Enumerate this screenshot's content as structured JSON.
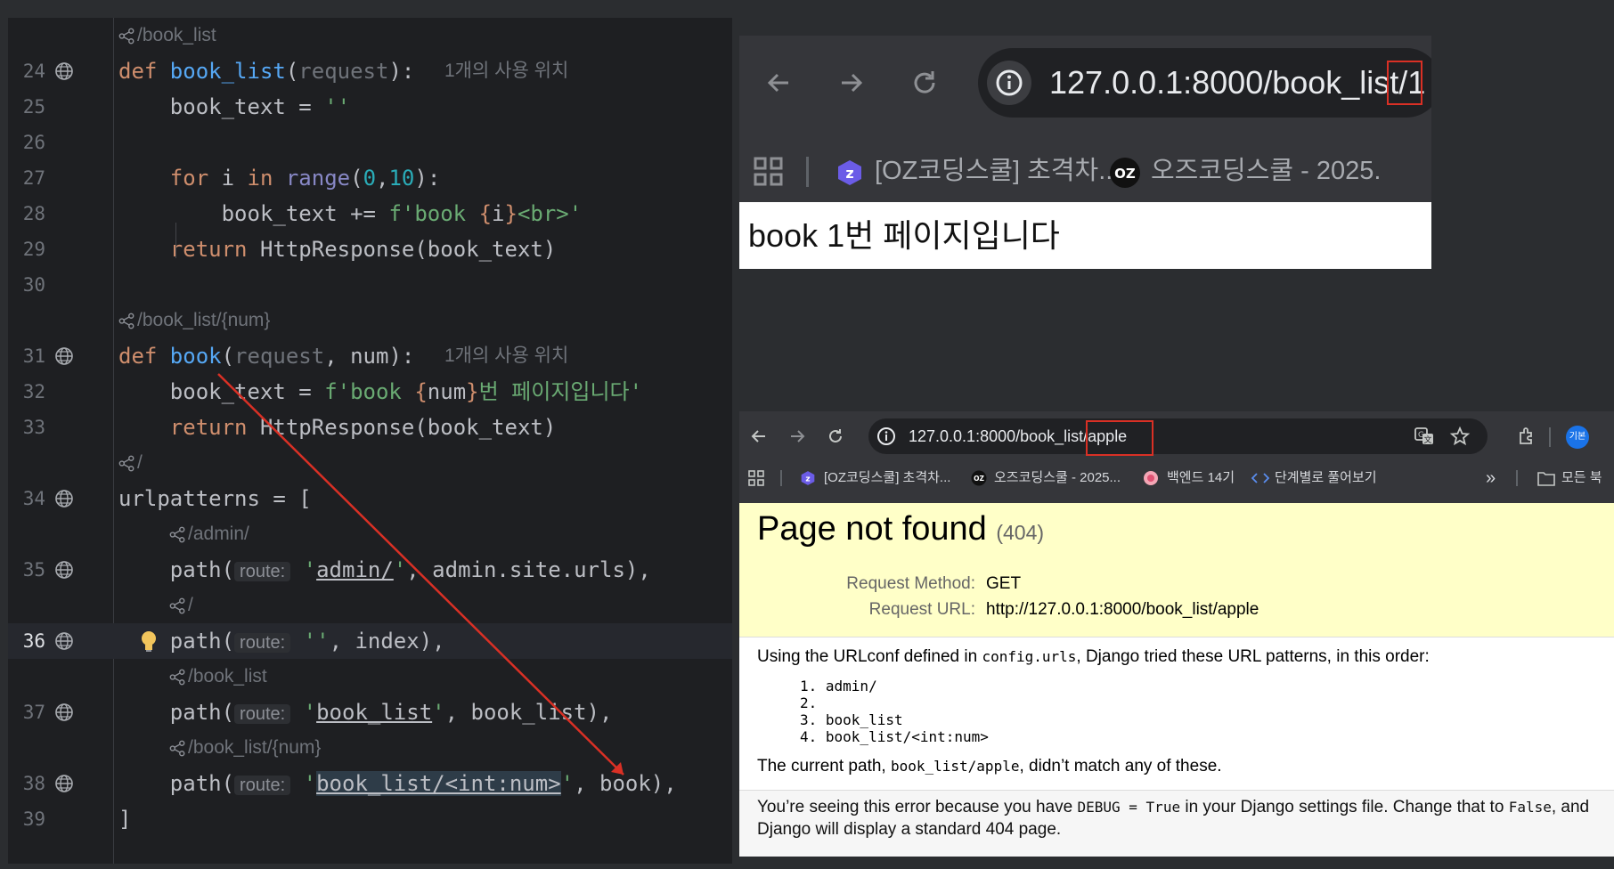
{
  "editor": {
    "lines": [
      {
        "type": "hint",
        "text": "/book_list",
        "indent": 0
      },
      {
        "type": "code",
        "num": "24",
        "globe": true,
        "usage": "1개의 사용 위치",
        "tokens": [
          [
            "kw",
            "def "
          ],
          [
            "fn",
            "book_list"
          ],
          [
            "",
            "("
          ],
          [
            "pa",
            "request"
          ],
          [
            "",
            "):"
          ]
        ]
      },
      {
        "type": "code",
        "num": "25",
        "tokens": [
          [
            "",
            "    book_text = "
          ],
          [
            "str",
            "''"
          ]
        ]
      },
      {
        "type": "code",
        "num": "26",
        "tokens": []
      },
      {
        "type": "code",
        "num": "27",
        "tokens": [
          [
            "kw",
            "    for "
          ],
          [
            "",
            "i "
          ],
          [
            "kw",
            "in "
          ],
          [
            "bi",
            "range"
          ],
          [
            "",
            "("
          ],
          [
            "num",
            "0"
          ],
          [
            "",
            ","
          ],
          [
            "num",
            "10"
          ],
          [
            "",
            "):"
          ]
        ]
      },
      {
        "type": "code",
        "num": "28",
        "tokens": [
          [
            "",
            "        book_text += "
          ],
          [
            "str",
            "f'book "
          ],
          [
            "br",
            "{"
          ],
          [
            "",
            "i"
          ],
          [
            "br",
            "}"
          ],
          [
            "str",
            "<br>'"
          ]
        ]
      },
      {
        "type": "code",
        "num": "29",
        "tokens": [
          [
            "kw",
            "    return "
          ],
          [
            "",
            "HttpResponse(book_text)"
          ]
        ]
      },
      {
        "type": "code",
        "num": "30",
        "tokens": []
      },
      {
        "type": "hint",
        "text": "/book_list/{num}",
        "indent": 0
      },
      {
        "type": "code",
        "num": "31",
        "globe": true,
        "usage": "1개의 사용 위치",
        "tokens": [
          [
            "kw",
            "def "
          ],
          [
            "fn",
            "book"
          ],
          [
            "",
            "("
          ],
          [
            "pa",
            "request"
          ],
          [
            "",
            ", num):"
          ]
        ]
      },
      {
        "type": "code",
        "num": "32",
        "tokens": [
          [
            "",
            "    book_text = "
          ],
          [
            "str",
            "f'book "
          ],
          [
            "br",
            "{"
          ],
          [
            "",
            "num"
          ],
          [
            "br",
            "}"
          ],
          [
            "str",
            "번 페이지입니다'"
          ]
        ]
      },
      {
        "type": "code",
        "num": "33",
        "tokens": [
          [
            "kw",
            "    return "
          ],
          [
            "",
            "HttpResponse(book_text)"
          ]
        ]
      },
      {
        "type": "hint",
        "text": "/",
        "indent": 0
      },
      {
        "type": "code",
        "num": "34",
        "globe": true,
        "tokens": [
          [
            "",
            "urlpatterns = ["
          ]
        ]
      },
      {
        "type": "hint",
        "text": "/admin/",
        "indent": 1
      },
      {
        "type": "code",
        "num": "35",
        "globe": true,
        "tokens": [
          [
            "",
            "    path("
          ],
          [
            "inlay",
            "route:"
          ],
          [
            "",
            " "
          ],
          [
            "str",
            "'"
          ],
          [
            "uhl",
            "admin/"
          ],
          [
            "str",
            "'"
          ],
          [
            "",
            ", admin.site.urls),"
          ]
        ]
      },
      {
        "type": "hint",
        "text": "/",
        "indent": 1
      },
      {
        "type": "code",
        "num": "36",
        "globe": true,
        "current": true,
        "bulb": true,
        "tokens": [
          [
            "",
            "    path("
          ],
          [
            "inlay",
            "route:"
          ],
          [
            "",
            " "
          ],
          [
            "str",
            "''"
          ],
          [
            "",
            ", index),"
          ]
        ]
      },
      {
        "type": "hint",
        "text": "/book_list",
        "indent": 1
      },
      {
        "type": "code",
        "num": "37",
        "globe": true,
        "tokens": [
          [
            "",
            "    path("
          ],
          [
            "inlay",
            "route:"
          ],
          [
            "",
            " "
          ],
          [
            "str",
            "'"
          ],
          [
            "uhl",
            "book_list"
          ],
          [
            "str",
            "'"
          ],
          [
            "",
            ", book_list),"
          ]
        ]
      },
      {
        "type": "hint",
        "text": "/book_list/{num}",
        "indent": 1
      },
      {
        "type": "code",
        "num": "38",
        "globe": true,
        "tokens": [
          [
            "",
            "    path("
          ],
          [
            "inlay",
            "route:"
          ],
          [
            "",
            " "
          ],
          [
            "str",
            "'"
          ],
          [
            "uhlbg",
            "book_list/<int:num>"
          ],
          [
            "str",
            "'"
          ],
          [
            "",
            ", book),"
          ]
        ]
      },
      {
        "type": "code",
        "num": "39",
        "tokens": [
          [
            "",
            "]"
          ]
        ]
      }
    ]
  },
  "browser_top": {
    "url": "127.0.0.1:8000/book_list/1",
    "bookmarks": [
      "[OZ코딩스쿨] 초격차...",
      "오즈코딩스쿨 - 2025."
    ],
    "page_text": "book 1번 페이지입니다"
  },
  "browser_bottom": {
    "url": "127.0.0.1:8000/book_list/apple",
    "profile_label": "기본",
    "bookmarks": [
      "[OZ코딩스쿨] 초격차...",
      "오즈코딩스쿨 - 2025...",
      "백엔드 14기",
      "단계별로 풀어보기"
    ],
    "more_label": "»",
    "all_bookmarks": "모든 북",
    "django": {
      "title": "Page not found",
      "code": "(404)",
      "method_label": "Request Method:",
      "method_value": "GET",
      "url_label": "Request URL:",
      "url_value": "http://127.0.0.1:8000/book_list/apple",
      "info_pre": "Using the URLconf defined in ",
      "info_mod": "config.urls",
      "info_post": ", Django tried these URL patterns, in this order:",
      "patterns": [
        "1. admin/",
        "2.",
        "3. book_list",
        "4. book_list/<int:num>"
      ],
      "cur_pre": "The current path, ",
      "cur_path": "book_list/apple",
      "cur_post": ", didn’t match any of these.",
      "foot_1": "You’re seeing this error because you have ",
      "foot_debug": "DEBUG = True",
      "foot_2": " in your Django settings file. Change that to ",
      "foot_false": "False",
      "foot_3": ", and Django will display a standard 404 page."
    }
  },
  "colors": {
    "highlight_box": "#d93025",
    "arrow": "#d93025",
    "django_header": "#ffffc8"
  }
}
